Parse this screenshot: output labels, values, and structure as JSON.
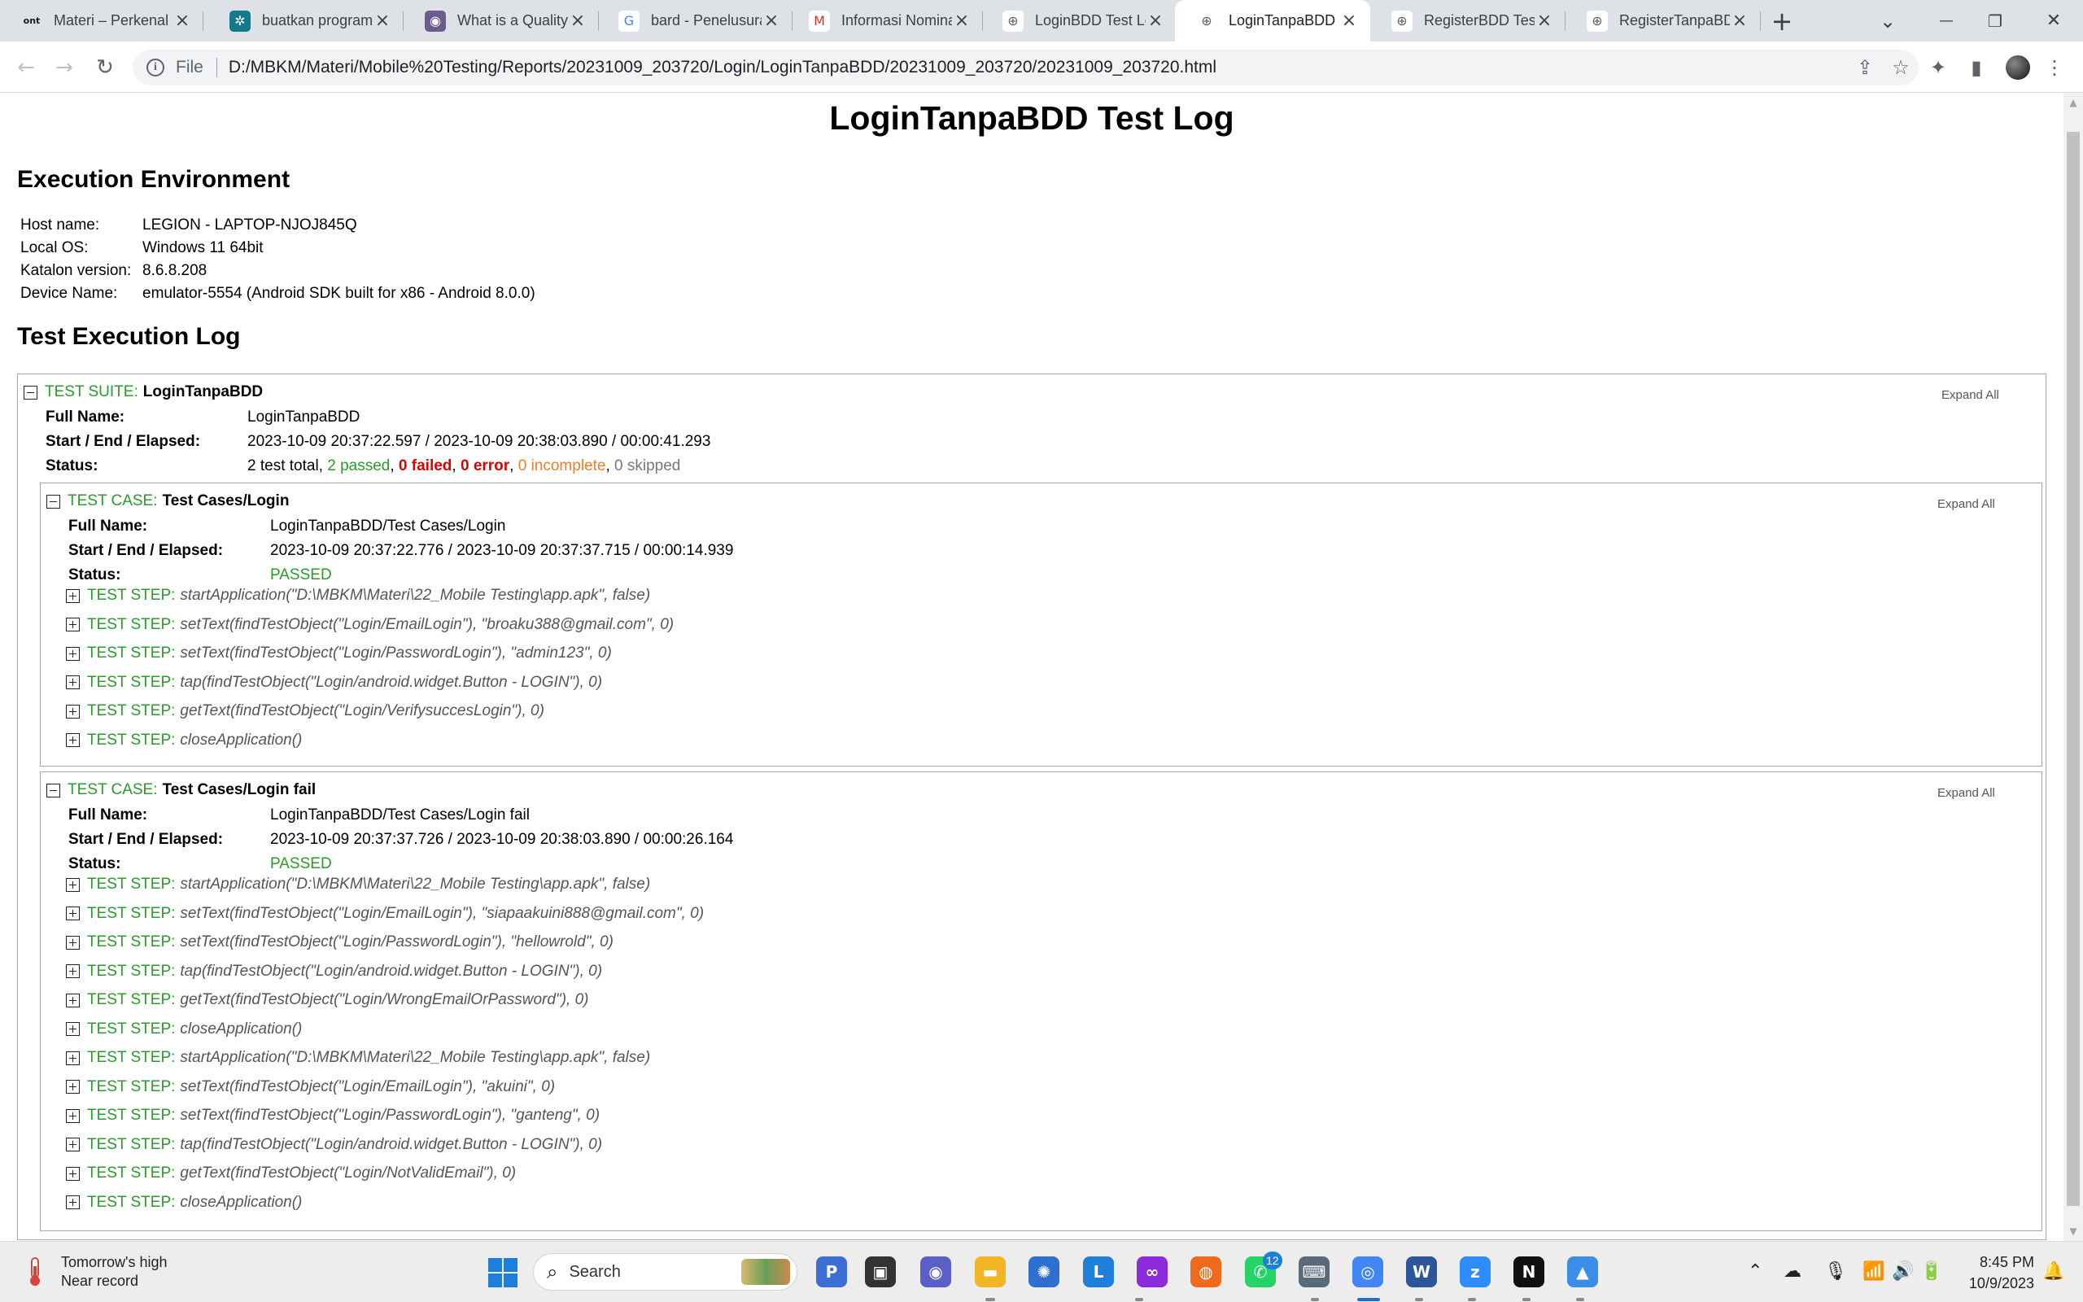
{
  "browser": {
    "tabs": [
      {
        "title": "Materi – Perkenal",
        "favicon": "ont",
        "color": "#1a1a1a",
        "fg": "#1a1a1a",
        "icon": "ont-logo-icon"
      },
      {
        "title": "buatkan program",
        "favicon": "✲",
        "color": "#127a8c",
        "fg": "#ffffff",
        "icon": "chatgpt-icon"
      },
      {
        "title": "What is a Quality",
        "favicon": "◉",
        "color": "#6b5b8f",
        "fg": "#ffffff",
        "icon": "site-icon"
      },
      {
        "title": "bard - Penelusura",
        "favicon": "G",
        "color": "#ffffff",
        "fg": "#4285f4",
        "icon": "google-icon"
      },
      {
        "title": "Informasi Nomina",
        "favicon": "M",
        "color": "#ffffff",
        "fg": "#d93025",
        "icon": "gmail-icon"
      },
      {
        "title": "LoginBDD Test Lo",
        "favicon": "⊕",
        "color": "#ffffff",
        "fg": "#5f6368",
        "icon": "globe-icon"
      },
      {
        "title": "LoginTanpaBDD T",
        "favicon": "⊕",
        "color": "#ffffff",
        "fg": "#5f6368",
        "icon": "globe-icon",
        "active": true
      },
      {
        "title": "RegisterBDD Test",
        "favicon": "⊕",
        "color": "#ffffff",
        "fg": "#5f6368",
        "icon": "globe-icon"
      },
      {
        "title": "RegisterTanpaBD",
        "favicon": "⊕",
        "color": "#ffffff",
        "fg": "#5f6368",
        "icon": "globe-icon"
      }
    ],
    "url_scheme": "File",
    "url": "D:/MBKM/Materi/Mobile%20Testing/Reports/20231009_203720/Login/LoginTanpaBDD/20231009_203720/20231009_203720.html"
  },
  "report": {
    "title": "LoginTanpaBDD Test Log",
    "env_heading": "Execution Environment",
    "env": [
      {
        "key": "Host name:",
        "value": "LEGION - LAPTOP-NJOJ845Q"
      },
      {
        "key": "Local OS:",
        "value": "Windows 11 64bit"
      },
      {
        "key": "Katalon version:",
        "value": "8.6.8.208"
      },
      {
        "key": "Device Name:",
        "value": "emulator-5554 (Android SDK built for x86 - Android 8.0.0)"
      }
    ],
    "log_heading": "Test Execution Log",
    "expand_all": "Expand All",
    "labels": {
      "full_name": "Full Name:",
      "start_end": "Start / End / Elapsed:",
      "status": "Status:",
      "test_suite": "TEST SUITE:",
      "test_case": "TEST CASE:",
      "test_step": "TEST STEP:"
    },
    "suite": {
      "name": "LoginTanpaBDD",
      "full_name": "LoginTanpaBDD",
      "timing": "2023-10-09 20:37:22.597 / 2023-10-09 20:38:03.890 / 00:00:41.293",
      "status_total": "2 test total,",
      "status_passed": "2 passed",
      "status_failed": "0 failed",
      "status_error": "0 error",
      "status_incomplete": "0 incomplete",
      "status_skipped": "0 skipped",
      "sep": ","
    },
    "cases": [
      {
        "name": "Test Cases/Login",
        "full_name": "LoginTanpaBDD/Test Cases/Login",
        "timing": "2023-10-09 20:37:22.776 / 2023-10-09 20:37:37.715 / 00:00:14.939",
        "status": "PASSED",
        "steps": [
          "startApplication(\"D:\\MBKM\\Materi\\22_Mobile Testing\\app.apk\", false)",
          "setText(findTestObject(\"Login/EmailLogin\"), \"broaku388@gmail.com\", 0)",
          "setText(findTestObject(\"Login/PasswordLogin\"), \"admin123\", 0)",
          "tap(findTestObject(\"Login/android.widget.Button - LOGIN\"), 0)",
          "getText(findTestObject(\"Login/VerifysuccesLogin\"), 0)",
          "closeApplication()"
        ]
      },
      {
        "name": "Test Cases/Login fail",
        "full_name": "LoginTanpaBDD/Test Cases/Login fail",
        "timing": "2023-10-09 20:37:37.726 / 2023-10-09 20:38:03.890 / 00:00:26.164",
        "status": "PASSED",
        "steps": [
          "startApplication(\"D:\\MBKM\\Materi\\22_Mobile Testing\\app.apk\", false)",
          "setText(findTestObject(\"Login/EmailLogin\"), \"siapaakuini888@gmail.com\", 0)",
          "setText(findTestObject(\"Login/PasswordLogin\"), \"hellowrold\", 0)",
          "tap(findTestObject(\"Login/android.widget.Button - LOGIN\"), 0)",
          "getText(findTestObject(\"Login/WrongEmailOrPassword\"), 0)",
          "closeApplication()",
          "startApplication(\"D:\\MBKM\\Materi\\22_Mobile Testing\\app.apk\", false)",
          "setText(findTestObject(\"Login/EmailLogin\"), \"akuini\", 0)",
          "setText(findTestObject(\"Login/PasswordLogin\"), \"ganteng\", 0)",
          "tap(findTestObject(\"Login/android.widget.Button - LOGIN\"), 0)",
          "getText(findTestObject(\"Login/NotValidEmail\"), 0)",
          "closeApplication()"
        ]
      }
    ]
  },
  "taskbar": {
    "weather_line1": "Tomorrow's high",
    "weather_line2": "Near record",
    "search_placeholder": "Search",
    "whatsapp_badge": "12",
    "time": "8:45 PM",
    "date": "10/9/2023"
  }
}
